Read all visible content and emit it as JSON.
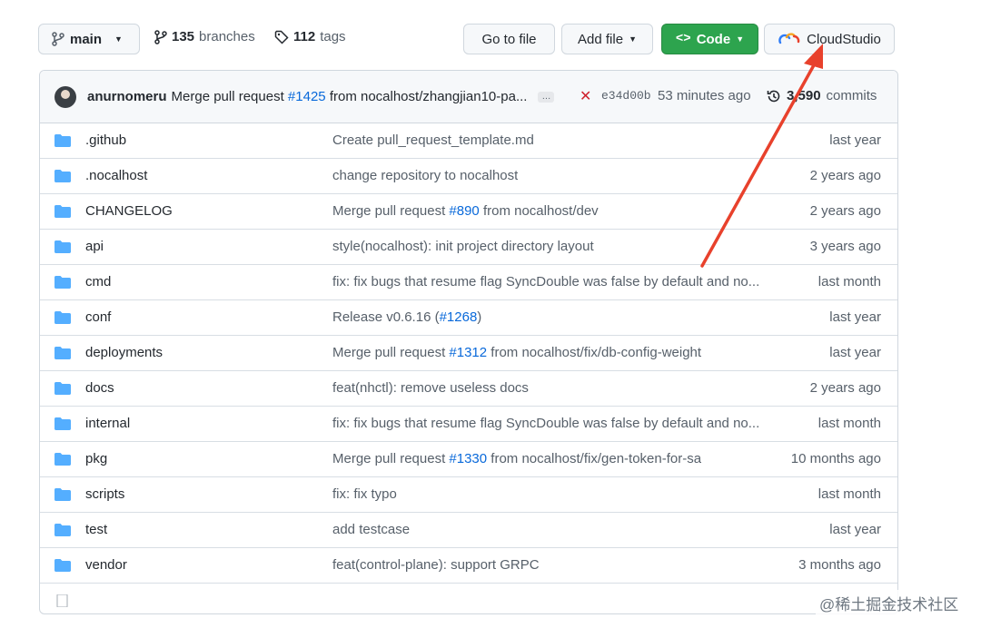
{
  "toolbar": {
    "branch_label": "main",
    "branches_count": "135",
    "branches_label": "branches",
    "tags_count": "112",
    "tags_label": "tags",
    "go_to_file": "Go to file",
    "add_file": "Add file",
    "code": "Code",
    "cloud_studio": "CloudStudio"
  },
  "commit": {
    "author": "anurnomeru",
    "message_prefix": "Merge pull request",
    "pr_link": "#1425",
    "message_suffix": "from nocalhost/zhangjian10-pa...",
    "ellipsis": "…",
    "status": "✕",
    "sha": "e34d00b",
    "time": "53 minutes ago",
    "commits_count": "3,590",
    "commits_label": "commits"
  },
  "files": [
    {
      "name": ".github",
      "msg": "Create pull_request_template.md",
      "link": "",
      "msg_suffix": "",
      "time": "last year"
    },
    {
      "name": ".nocalhost",
      "msg": "change repository to nocalhost",
      "link": "",
      "msg_suffix": "",
      "time": "2 years ago"
    },
    {
      "name": "CHANGELOG",
      "msg": "Merge pull request ",
      "link": "#890",
      "msg_suffix": " from nocalhost/dev",
      "time": "2 years ago"
    },
    {
      "name": "api",
      "msg": "style(nocalhost): init project directory layout",
      "link": "",
      "msg_suffix": "",
      "time": "3 years ago"
    },
    {
      "name": "cmd",
      "msg": "fix: fix bugs that resume flag SyncDouble was false by default and no...",
      "link": "",
      "msg_suffix": "",
      "time": "last month"
    },
    {
      "name": "conf",
      "msg": "Release v0.6.16 (",
      "link": "#1268",
      "msg_suffix": ")",
      "time": "last year"
    },
    {
      "name": "deployments",
      "msg": "Merge pull request ",
      "link": "#1312",
      "msg_suffix": " from nocalhost/fix/db-config-weight",
      "time": "last year"
    },
    {
      "name": "docs",
      "msg": "feat(nhctl): remove useless docs",
      "link": "",
      "msg_suffix": "",
      "time": "2 years ago"
    },
    {
      "name": "internal",
      "msg": "fix: fix bugs that resume flag SyncDouble was false by default and no...",
      "link": "",
      "msg_suffix": "",
      "time": "last month"
    },
    {
      "name": "pkg",
      "msg": "Merge pull request ",
      "link": "#1330",
      "msg_suffix": " from nocalhost/fix/gen-token-for-sa",
      "time": "10 months ago"
    },
    {
      "name": "scripts",
      "msg": "fix: fix typo",
      "link": "",
      "msg_suffix": "",
      "time": "last month"
    },
    {
      "name": "test",
      "msg": "add testcase",
      "link": "",
      "msg_suffix": "",
      "time": "last year"
    },
    {
      "name": "vendor",
      "msg": "feat(control-plane): support GRPC",
      "link": "",
      "msg_suffix": "",
      "time": "3 months ago"
    }
  ],
  "watermark": "@稀土掘金技术社区",
  "colors": {
    "accent_link": "#0969da",
    "code_button": "#2da44e",
    "arrow": "#e8412c",
    "folder": "#54aeff"
  }
}
